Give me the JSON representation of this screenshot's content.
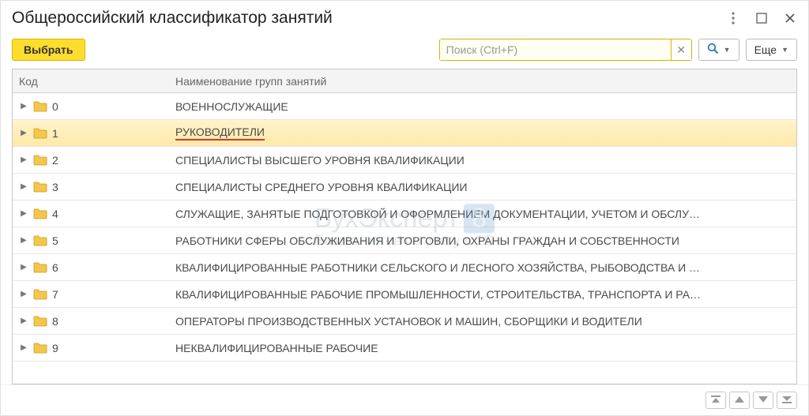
{
  "window": {
    "title": "Общероссийский классификатор занятий"
  },
  "toolbar": {
    "select_label": "Выбрать",
    "search_placeholder": "Поиск (Ctrl+F)",
    "more_label": "Еще"
  },
  "columns": {
    "code": "Код",
    "name": "Наименование групп занятий"
  },
  "rows": [
    {
      "code": "0",
      "name": "ВОЕННОСЛУЖАЩИЕ",
      "selected": false
    },
    {
      "code": "1",
      "name": "РУКОВОДИТЕЛИ",
      "selected": true,
      "underline": true
    },
    {
      "code": "2",
      "name": "СПЕЦИАЛИСТЫ ВЫСШЕГО УРОВНЯ КВАЛИФИКАЦИИ",
      "selected": false
    },
    {
      "code": "3",
      "name": "СПЕЦИАЛИСТЫ СРЕДНЕГО УРОВНЯ КВАЛИФИКАЦИИ",
      "selected": false
    },
    {
      "code": "4",
      "name": "СЛУЖАЩИЕ, ЗАНЯТЫЕ ПОДГОТОВКОЙ И ОФОРМЛЕНИЕМ ДОКУМЕНТАЦИИ, УЧЕТОМ И ОБСЛУ…",
      "selected": false
    },
    {
      "code": "5",
      "name": "РАБОТНИКИ СФЕРЫ ОБСЛУЖИВАНИЯ И ТОРГОВЛИ, ОХРАНЫ ГРАЖДАН И СОБСТВЕННОСТИ",
      "selected": false
    },
    {
      "code": "6",
      "name": "КВАЛИФИЦИРОВАННЫЕ РАБОТНИКИ СЕЛЬСКОГО И ЛЕСНОГО ХОЗЯЙСТВА, РЫБОВОДСТВА И …",
      "selected": false
    },
    {
      "code": "7",
      "name": "КВАЛИФИЦИРОВАННЫЕ РАБОЧИЕ ПРОМЫШЛЕННОСТИ, СТРОИТЕЛЬСТВА, ТРАНСПОРТА И РА…",
      "selected": false
    },
    {
      "code": "8",
      "name": "ОПЕРАТОРЫ ПРОИЗВОДСТВЕННЫХ УСТАНОВОК И МАШИН, СБОРЩИКИ И ВОДИТЕЛИ",
      "selected": false
    },
    {
      "code": "9",
      "name": "НЕКВАЛИФИЦИРОВАННЫЕ РАБОЧИЕ",
      "selected": false
    }
  ],
  "watermark": {
    "line1": "БухЭксперт",
    "badge": "8",
    "line2": "База ответов по учету в 1С"
  },
  "icons": {
    "more_vertical": "more-vertical-icon",
    "maximize": "maximize-icon",
    "close": "close-icon",
    "search": "search-icon",
    "folder": "folder-icon",
    "chevron_right": "chevron-right-icon",
    "clear": "clear-icon",
    "nav_first": "nav-first-icon",
    "nav_up": "nav-up-icon",
    "nav_down": "nav-down-icon",
    "nav_last": "nav-last-icon"
  },
  "colors": {
    "accent_yellow": "#ffdd2d",
    "accent_border": "#d9b300",
    "selection_bg": "#ffe9a8",
    "underline_red": "#d43a2f",
    "search_blue": "#1a6fb0"
  }
}
